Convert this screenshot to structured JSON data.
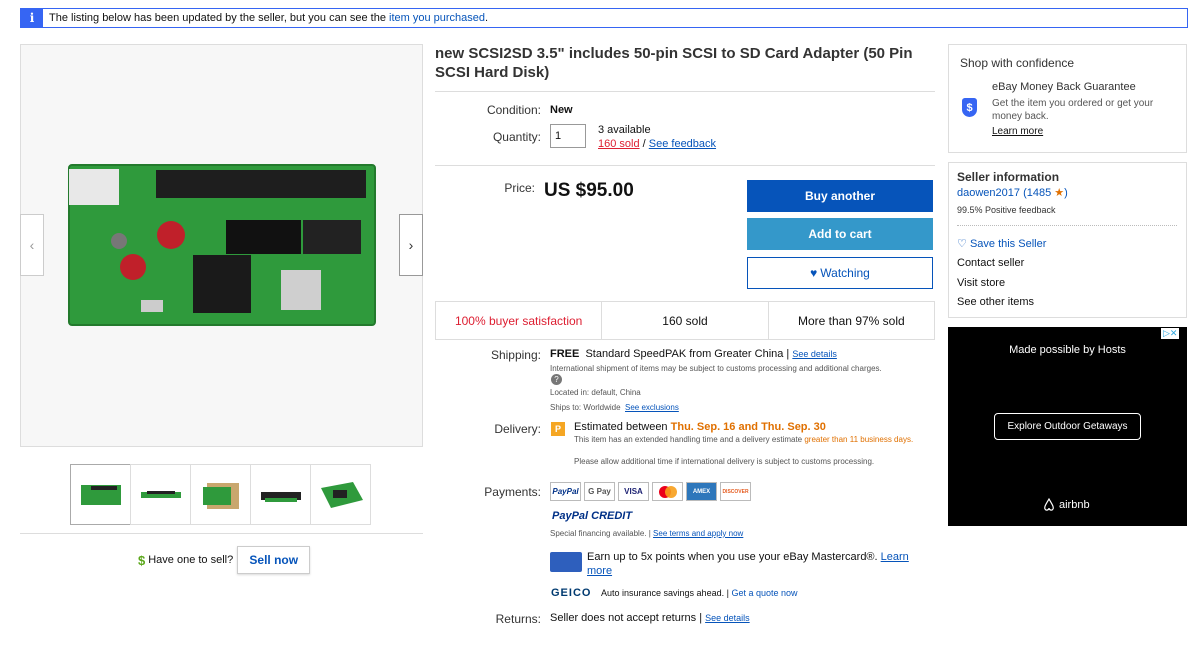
{
  "notice": {
    "info_icon": "i",
    "text": "The listing below has been updated by the seller, but you can see the ",
    "link": "item you purchased",
    "suffix": "."
  },
  "gallery": {
    "prev_icon": "‹",
    "next_icon": "›",
    "thumbnails": [
      "thumb-1",
      "thumb-2",
      "thumb-3",
      "thumb-4",
      "thumb-5"
    ],
    "sell": {
      "dollar": "$",
      "text": "Have one to sell?",
      "button": "Sell now"
    }
  },
  "item": {
    "title": "new SCSI2SD 3.5\" includes 50-pin SCSI to SD Card Adapter (50 Pin SCSI Hard Disk)",
    "condition_label": "Condition:",
    "condition": "New",
    "quantity_label": "Quantity:",
    "quantity_value": "1",
    "available": "3 available",
    "sold_link": "160 sold",
    "slash": " / ",
    "feedback_link": "See feedback",
    "price_label": "Price:",
    "price": "US $95.00",
    "buy_button": "Buy another",
    "cart_button": "Add to cart",
    "watch_button": "Watching",
    "heart_icon": "♥"
  },
  "stats": [
    "100% buyer satisfaction",
    "160 sold",
    "More than 97% sold"
  ],
  "shipping": {
    "label": "Shipping:",
    "free": "FREE",
    "method": "Standard SpeedPAK from Greater China |",
    "details": "See details",
    "note": "International shipment of items may be subject to customs processing and additional charges.",
    "help_icon": "?",
    "located": "Located in:  default, China",
    "ships_to": "Ships to:  Worldwide",
    "exclusions": "See exclusions"
  },
  "delivery": {
    "label": "Delivery:",
    "badge": "P",
    "estimated": "Estimated between ",
    "dates": "Thu. Sep. 16 and Thu. Sep. 30",
    "handling": "This item has an extended handling time and a delivery estimate ",
    "greater": "greater than 11 business days.",
    "allow": "Please allow additional time if international delivery is subject to customs processing."
  },
  "payments": {
    "label": "Payments:",
    "methods": [
      "PayPal",
      "G Pay",
      "VISA",
      "MC",
      "AMEX",
      "DISCOVER"
    ],
    "paypal_credit": "PayPal CREDIT",
    "special": "Special financing available.  |",
    "terms": "See terms and apply now",
    "mastercard": "Earn up to 5x points when you use your eBay Mastercard®.",
    "learn": "Learn more",
    "geico_logo": "GEICO",
    "geico": "Auto insurance savings ahead. |",
    "geico_link": "Get a quote now"
  },
  "returns": {
    "label": "Returns:",
    "text": "Seller does not accept returns |",
    "details": "See details"
  },
  "confidence": {
    "title": "Shop with confidence",
    "shield_icon": "$",
    "guarantee": "eBay Money Back Guarantee",
    "desc": "Get the item you ordered or get your money back.",
    "learn": "Learn more"
  },
  "seller": {
    "title": "Seller information",
    "name": "daowen2017",
    "score": "1485",
    "star_icon": "★",
    "positive": "99.5% Positive feedback",
    "save": "Save this Seller",
    "heart_icon": "♡",
    "contact": "Contact seller",
    "store": "Visit store",
    "other": "See other items"
  },
  "ad": {
    "close": "▷✕",
    "headline": "Made possible by Hosts",
    "button": "Explore Outdoor Getaways",
    "brand": "airbnb"
  }
}
